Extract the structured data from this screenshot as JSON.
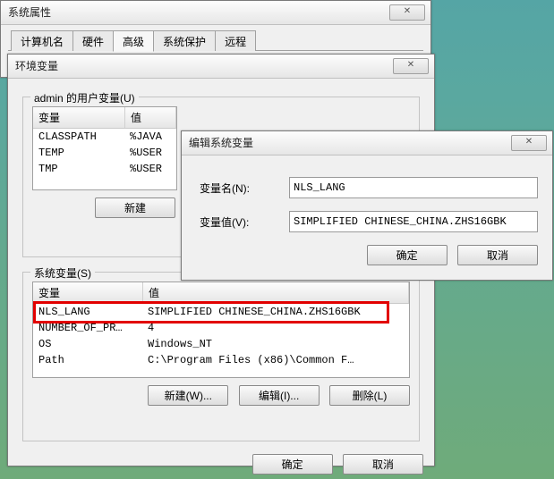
{
  "sysprops": {
    "title": "系统属性",
    "tabs": [
      "计算机名",
      "硬件",
      "高级",
      "系统保护",
      "远程"
    ],
    "active_tab_index": 2
  },
  "envvars": {
    "title": "环境变量",
    "user_group_label": "admin 的用户变量(U)",
    "user_list": {
      "col_var": "变量",
      "col_val": "值",
      "rows": [
        {
          "var": "CLASSPATH",
          "val": "%JAVA"
        },
        {
          "var": "TEMP",
          "val": "%USER"
        },
        {
          "var": "TMP",
          "val": "%USER"
        }
      ]
    },
    "user_new_btn": "新建",
    "sys_group_label": "系统变量(S)",
    "sys_list": {
      "col_var": "变量",
      "col_val": "值",
      "rows": [
        {
          "var": "NLS_LANG",
          "val": "SIMPLIFIED CHINESE_CHINA.ZHS16GBK"
        },
        {
          "var": "NUMBER_OF_PR…",
          "val": "4"
        },
        {
          "var": "OS",
          "val": "Windows_NT"
        },
        {
          "var": "Path",
          "val": "C:\\Program Files (x86)\\Common F…"
        }
      ]
    },
    "sys_new_btn": "新建(W)...",
    "sys_edit_btn": "编辑(I)...",
    "sys_del_btn": "删除(L)",
    "ok_btn": "确定",
    "cancel_btn": "取消"
  },
  "editdlg": {
    "title": "编辑系统变量",
    "name_label": "变量名(N):",
    "value_label": "变量值(V):",
    "name_value": "NLS_LANG",
    "value_value": "SIMPLIFIED CHINESE_CHINA.ZHS16GBK",
    "ok_btn": "确定",
    "cancel_btn": "取消"
  }
}
